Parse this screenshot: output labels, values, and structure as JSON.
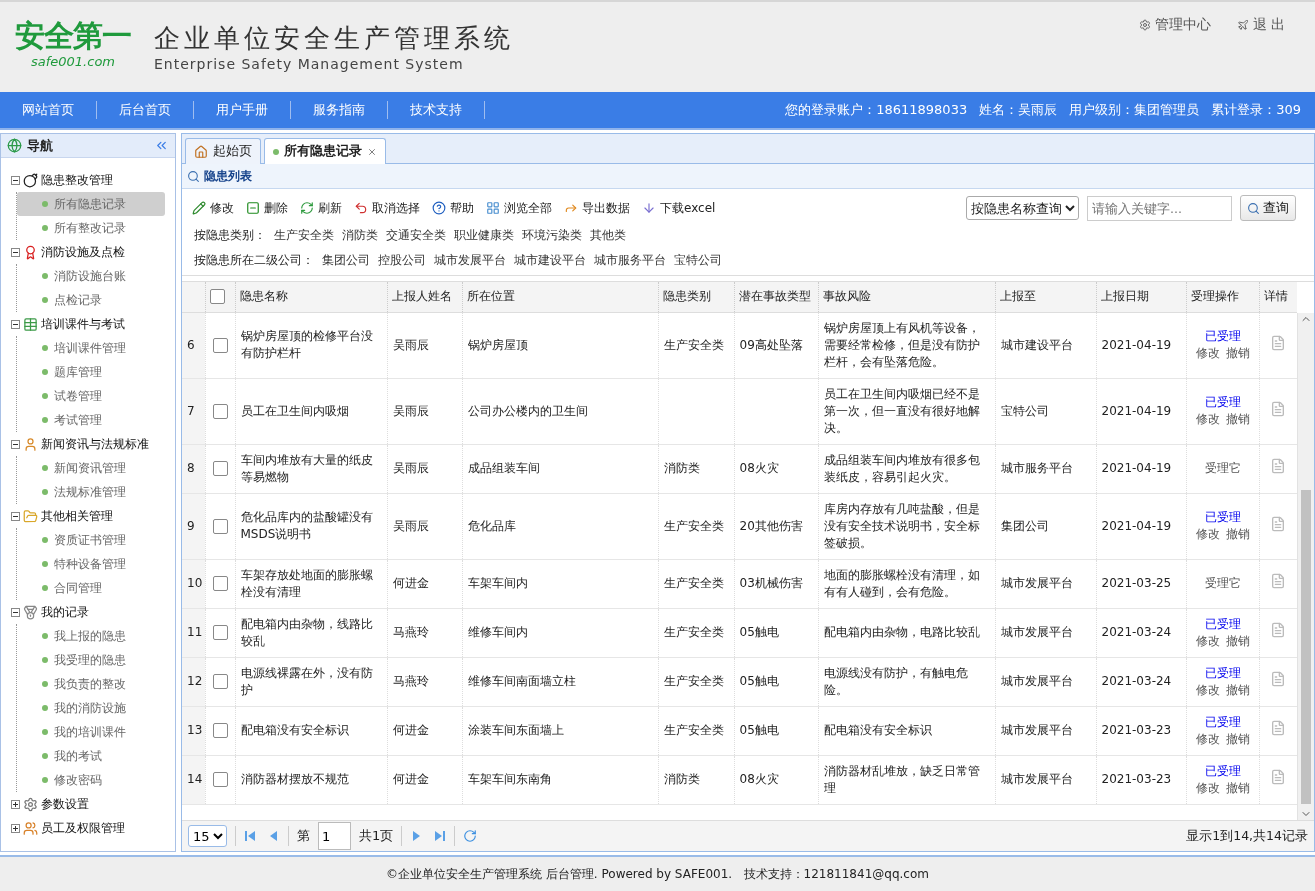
{
  "header": {
    "logo": "安全第一",
    "logo_sub": "safe001.com",
    "title": "企业单位安全生产管理系统",
    "subtitle": "Enterprise Safety Management System",
    "links": [
      "管理中心",
      "退 出"
    ]
  },
  "nav": {
    "items": [
      "网站首页",
      "后台首页",
      "用户手册",
      "服务指南",
      "技术支持"
    ],
    "account": [
      "您的登录账户：18611898033",
      "姓名：吴雨辰",
      "用户级别：集团管理员",
      "累计登录：309"
    ]
  },
  "sidebar": {
    "title": "导航",
    "groups": [
      {
        "label": "隐患整改管理",
        "expanded": true,
        "children": [
          {
            "label": "所有隐患记录",
            "selected": true
          },
          {
            "label": "所有整改记录",
            "selected": false
          }
        ]
      },
      {
        "label": "消防设施及点检",
        "expanded": true,
        "children": [
          {
            "label": "消防设施台账",
            "selected": false
          },
          {
            "label": "点检记录",
            "selected": false
          }
        ]
      },
      {
        "label": "培训课件与考试",
        "expanded": true,
        "children": [
          {
            "label": "培训课件管理",
            "selected": false
          },
          {
            "label": "题库管理",
            "selected": false
          },
          {
            "label": "试卷管理",
            "selected": false
          },
          {
            "label": "考试管理",
            "selected": false
          }
        ]
      },
      {
        "label": "新闻资讯与法规标准",
        "expanded": true,
        "children": [
          {
            "label": "新闻资讯管理",
            "selected": false
          },
          {
            "label": "法规标准管理",
            "selected": false
          }
        ]
      },
      {
        "label": "其他相关管理",
        "expanded": true,
        "children": [
          {
            "label": "资质证书管理",
            "selected": false
          },
          {
            "label": "特种设备管理",
            "selected": false
          },
          {
            "label": "合同管理",
            "selected": false
          }
        ]
      },
      {
        "label": "我的记录",
        "expanded": true,
        "children": [
          {
            "label": "我上报的隐患",
            "selected": false
          },
          {
            "label": "我受理的隐患",
            "selected": false
          },
          {
            "label": "我负责的整改",
            "selected": false
          },
          {
            "label": "我的消防设施",
            "selected": false
          },
          {
            "label": "我的培训课件",
            "selected": false
          },
          {
            "label": "我的考试",
            "selected": false
          },
          {
            "label": "修改密码",
            "selected": false
          }
        ]
      },
      {
        "label": "参数设置",
        "expanded": false
      },
      {
        "label": "员工及权限管理",
        "expanded": false
      }
    ]
  },
  "tabs": [
    {
      "label": "起始页",
      "selected": false
    },
    {
      "label": "所有隐患记录",
      "selected": true
    }
  ],
  "panel": {
    "title": "隐患列表",
    "toolbar": [
      "修改",
      "删除",
      "刷新",
      "取消选择",
      "帮助",
      "浏览全部",
      "导出数据",
      "下载excel"
    ],
    "filters": [
      {
        "label": "按隐患类别：",
        "options": [
          "生产安全类",
          "消防类",
          "交通安全类",
          "职业健康类",
          "环境污染类",
          "其他类"
        ]
      },
      {
        "label": "按隐患所在二级公司：",
        "options": [
          "集团公司",
          "控股公司",
          "城市发展平台",
          "城市建设平台",
          "城市服务平台",
          "宝特公司"
        ]
      }
    ],
    "search": {
      "mode": "按隐患名称查询",
      "placeholder": "请输入关键字...",
      "button": "查询"
    }
  },
  "table": {
    "header_checked": false,
    "columns": [
      "隐患名称",
      "上报人姓名",
      "所在位置",
      "隐患类别",
      "潜在事故类型",
      "事故风险",
      "上报至",
      "上报日期",
      "受理操作",
      "详情"
    ],
    "rows": [
      {
        "index": "6",
        "checked": false,
        "name": "锅炉房屋顶的检修平台没有防护栏杆",
        "reporter": "吴雨辰",
        "location": "锅炉房屋顶",
        "category": "生产安全类",
        "accident_type": "09高处坠落",
        "risk": "锅炉房屋顶上有风机等设备，需要经常检修，但是没有防护栏杆，会有坠落危险。",
        "reported_to": "城市建设平台",
        "date": "2021-04-19",
        "accepted": true,
        "status": "已受理",
        "actions": [
          "修改",
          "撤销"
        ]
      },
      {
        "index": "7",
        "checked": false,
        "name": "员工在卫生间内吸烟",
        "reporter": "吴雨辰",
        "location": "公司办公楼内的卫生间",
        "risk": "员工在卫生间内吸烟已经不是第一次，但一直没有很好地解决。",
        "reported_to": "宝特公司",
        "date": "2021-04-19",
        "accepted": true,
        "status": "已受理",
        "actions": [
          "修改",
          "撤销"
        ]
      },
      {
        "index": "8",
        "checked": false,
        "name": "车间内堆放有大量的纸皮等易燃物",
        "reporter": "吴雨辰",
        "location": "成品组装车间",
        "category": "消防类",
        "accident_type": "08火灾",
        "risk": "成品组装车间内堆放有很多包装纸皮，容易引起火灾。",
        "reported_to": "城市服务平台",
        "date": "2021-04-19",
        "accepted": false,
        "status": "受理它"
      },
      {
        "index": "9",
        "checked": false,
        "name": "危化品库内的盐酸罐没有MSDS说明书",
        "reporter": "吴雨辰",
        "location": "危化品库",
        "category": "生产安全类",
        "accident_type": "20其他伤害",
        "risk": "库房内存放有几吨盐酸，但是没有安全技术说明书，安全标签破损。",
        "reported_to": "集团公司",
        "date": "2021-04-19",
        "accepted": true,
        "status": "已受理",
        "actions": [
          "修改",
          "撤销"
        ]
      },
      {
        "index": "10",
        "checked": false,
        "name": "车架存放处地面的膨胀螺栓没有清理",
        "reporter": "何进金",
        "location": "车架车间内",
        "category": "生产安全类",
        "accident_type": "03机械伤害",
        "risk": "地面的膨胀螺栓没有清理，如有有人碰到，会有危险。",
        "reported_to": "城市发展平台",
        "date": "2021-03-25",
        "accepted": false,
        "status": "受理它"
      },
      {
        "index": "11",
        "checked": false,
        "name": "配电箱内由杂物，线路比较乱",
        "reporter": "马燕玲",
        "location": "维修车间内",
        "category": "生产安全类",
        "accident_type": "05触电",
        "risk": "配电箱内由杂物，电路比较乱",
        "reported_to": "城市发展平台",
        "date": "2021-03-24",
        "accepted": true,
        "status": "已受理",
        "actions": [
          "修改",
          "撤销"
        ]
      },
      {
        "index": "12",
        "checked": false,
        "name": "电源线裸露在外，没有防护",
        "reporter": "马燕玲",
        "location": "维修车间南面墙立柱",
        "category": "生产安全类",
        "accident_type": "05触电",
        "risk": "电源线没有防护，有触电危险。",
        "reported_to": "城市发展平台",
        "date": "2021-03-24",
        "accepted": true,
        "status": "已受理",
        "actions": [
          "修改",
          "撤销"
        ]
      },
      {
        "index": "13",
        "checked": false,
        "name": "配电箱没有安全标识",
        "reporter": "何进金",
        "location": "涂装车间东面墙上",
        "category": "生产安全类",
        "accident_type": "05触电",
        "risk": "配电箱没有安全标识",
        "reported_to": "城市发展平台",
        "date": "2021-03-23",
        "accepted": true,
        "status": "已受理",
        "actions": [
          "修改",
          "撤销"
        ]
      },
      {
        "index": "14",
        "checked": false,
        "name": "消防器材摆放不规范",
        "reporter": "何进金",
        "location": "车架车间东南角",
        "category": "消防类",
        "accident_type": "08火灾",
        "risk": "消防器材乱堆放，缺乏日常管理",
        "reported_to": "城市发展平台",
        "date": "2021-03-23",
        "accepted": true,
        "status": "已受理",
        "actions": [
          "修改",
          "撤销"
        ]
      }
    ]
  },
  "pager": {
    "page_size": "15",
    "page_label": "第",
    "page": "1",
    "total_pages": "共1页",
    "summary": "显示1到14,共14记录"
  },
  "footer": "©企业单位安全生产管理系统 后台管理. Powered by SAFE001.   技术支持：121811841@qq.com"
}
